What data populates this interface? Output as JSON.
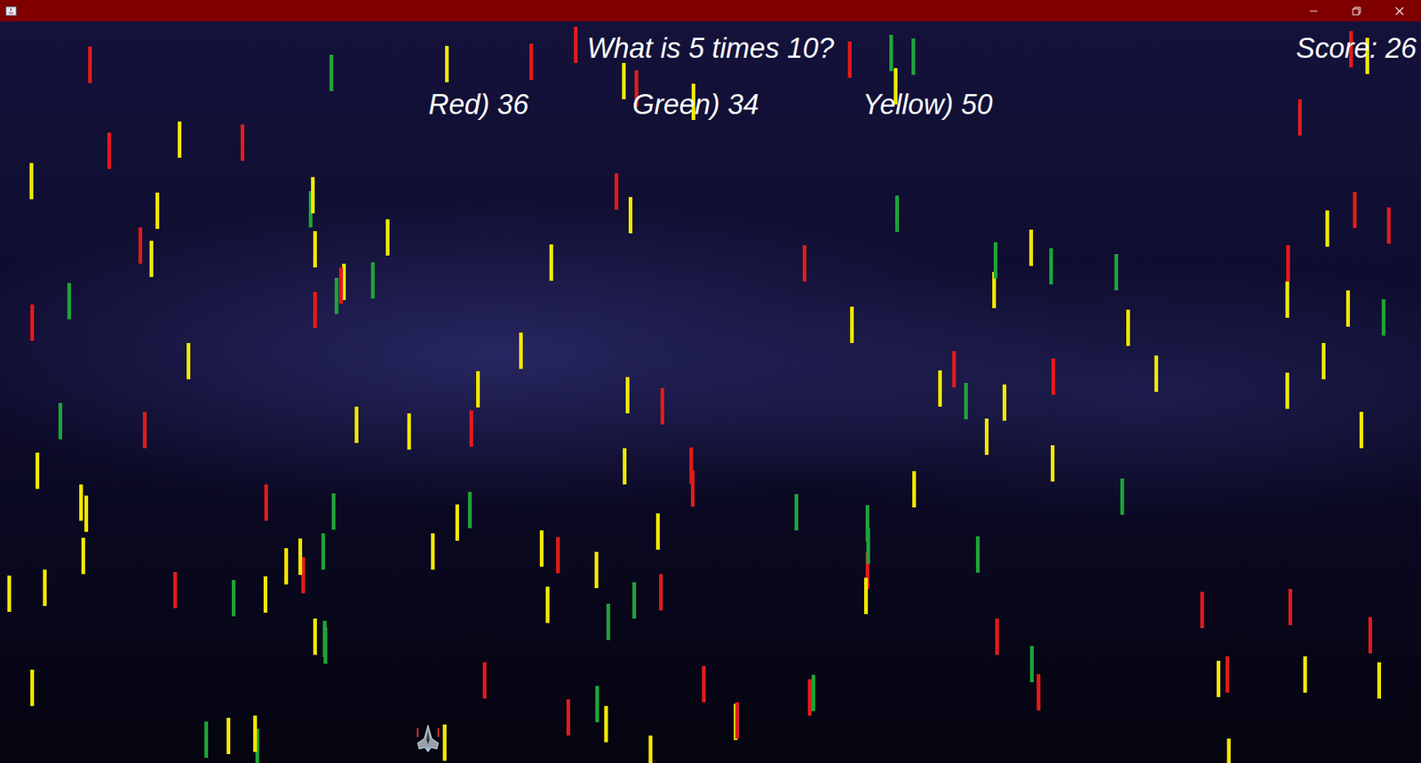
{
  "question": "What is 5 times 10?",
  "score": "Score: 26",
  "answers": [
    {
      "label": "Red) 36"
    },
    {
      "label": "Green) 34"
    },
    {
      "label": "Yellow) 50"
    }
  ],
  "bars": [
    {
      "color": "#f2e600"
    },
    {
      "color": "#e01b1b"
    },
    {
      "color": "#1ea33a"
    },
    {
      "color": "#f2e600"
    },
    {
      "color": "#f2e600"
    },
    {
      "color": "#e01b1b"
    },
    {
      "color": "#1ea33a"
    },
    {
      "color": "#f2e600"
    },
    {
      "color": "#e01b1b"
    },
    {
      "color": "#f2e600"
    },
    {
      "color": "#1ea33a"
    },
    {
      "color": "#f2e600"
    },
    {
      "color": "#e01b1b"
    },
    {
      "color": "#f2e600"
    },
    {
      "color": "#f2e600"
    },
    {
      "color": "#1ea33a"
    },
    {
      "color": "#e01b1b"
    },
    {
      "color": "#f2e600"
    },
    {
      "color": "#e01b1b"
    },
    {
      "color": "#f2e600"
    },
    {
      "color": "#f2e600"
    },
    {
      "color": "#1ea33a"
    },
    {
      "color": "#e01b1b"
    },
    {
      "color": "#f2e600"
    },
    {
      "color": "#1ea33a"
    },
    {
      "color": "#f2e600"
    },
    {
      "color": "#e01b1b"
    },
    {
      "color": "#f2e600"
    },
    {
      "color": "#f2e600"
    },
    {
      "color": "#e01b1b"
    },
    {
      "color": "#1ea33a"
    },
    {
      "color": "#f2e600"
    },
    {
      "color": "#e01b1b"
    },
    {
      "color": "#f2e600"
    },
    {
      "color": "#1ea33a"
    },
    {
      "color": "#f2e600"
    },
    {
      "color": "#e01b1b"
    },
    {
      "color": "#f2e600"
    },
    {
      "color": "#1ea33a"
    },
    {
      "color": "#e01b1b"
    },
    {
      "color": "#f2e600"
    },
    {
      "color": "#f2e600"
    },
    {
      "color": "#e01b1b"
    },
    {
      "color": "#1ea33a"
    },
    {
      "color": "#f2e600"
    },
    {
      "color": "#e01b1b"
    },
    {
      "color": "#f2e600"
    },
    {
      "color": "#1ea33a"
    },
    {
      "color": "#f2e600"
    },
    {
      "color": "#e01b1b"
    },
    {
      "color": "#f2e600"
    },
    {
      "color": "#1ea33a"
    },
    {
      "color": "#e01b1b"
    },
    {
      "color": "#f2e600"
    },
    {
      "color": "#f2e600"
    },
    {
      "color": "#e01b1b"
    },
    {
      "color": "#1ea33a"
    },
    {
      "color": "#f2e600"
    },
    {
      "color": "#e01b1b"
    },
    {
      "color": "#f2e600"
    },
    {
      "color": "#1ea33a"
    },
    {
      "color": "#f2e600"
    },
    {
      "color": "#e01b1b"
    },
    {
      "color": "#f2e600"
    },
    {
      "color": "#1ea33a"
    },
    {
      "color": "#e01b1b"
    },
    {
      "color": "#f2e600"
    },
    {
      "color": "#f2e600"
    },
    {
      "color": "#e01b1b"
    },
    {
      "color": "#1ea33a"
    },
    {
      "color": "#f2e600"
    },
    {
      "color": "#e01b1b"
    },
    {
      "color": "#f2e600"
    },
    {
      "color": "#1ea33a"
    },
    {
      "color": "#f2e600"
    },
    {
      "color": "#e01b1b"
    },
    {
      "color": "#f2e600"
    },
    {
      "color": "#1ea33a"
    },
    {
      "color": "#e01b1b"
    },
    {
      "color": "#f2e600"
    },
    {
      "color": "#f2e600"
    },
    {
      "color": "#e01b1b"
    },
    {
      "color": "#1ea33a"
    },
    {
      "color": "#f2e600"
    },
    {
      "color": "#e01b1b"
    },
    {
      "color": "#f2e600"
    },
    {
      "color": "#1ea33a"
    },
    {
      "color": "#f2e600"
    },
    {
      "color": "#e01b1b"
    },
    {
      "color": "#f2e600"
    },
    {
      "color": "#1ea33a"
    },
    {
      "color": "#e01b1b"
    },
    {
      "color": "#f2e600"
    },
    {
      "color": "#f2e600"
    },
    {
      "color": "#e01b1b"
    },
    {
      "color": "#1ea33a"
    },
    {
      "color": "#f2e600"
    },
    {
      "color": "#e01b1b"
    },
    {
      "color": "#f2e600"
    },
    {
      "color": "#1ea33a"
    },
    {
      "color": "#f2e600"
    },
    {
      "color": "#e01b1b"
    },
    {
      "color": "#f2e600"
    },
    {
      "color": "#1ea33a"
    },
    {
      "color": "#e01b1b"
    },
    {
      "color": "#f2e600"
    },
    {
      "color": "#f2e600"
    },
    {
      "color": "#e01b1b"
    },
    {
      "color": "#1ea33a"
    },
    {
      "color": "#f2e600"
    },
    {
      "color": "#e01b1b"
    },
    {
      "color": "#f2e600"
    },
    {
      "color": "#1ea33a"
    },
    {
      "color": "#f2e600"
    },
    {
      "color": "#e01b1b"
    },
    {
      "color": "#f2e600"
    },
    {
      "color": "#1ea33a"
    },
    {
      "color": "#e01b1b"
    },
    {
      "color": "#f2e600"
    },
    {
      "color": "#f2e600"
    },
    {
      "color": "#e01b1b"
    },
    {
      "color": "#1ea33a"
    },
    {
      "color": "#f2e600"
    },
    {
      "color": "#e01b1b"
    },
    {
      "color": "#f2e600"
    },
    {
      "color": "#1ea33a"
    },
    {
      "color": "#f2e600"
    },
    {
      "color": "#e01b1b"
    },
    {
      "color": "#f2e600"
    },
    {
      "color": "#1ea33a"
    },
    {
      "color": "#f2e600"
    },
    {
      "color": "#e01b1b"
    },
    {
      "color": "#f2e600"
    },
    {
      "color": "#1ea33a"
    },
    {
      "color": "#e01b1b"
    },
    {
      "color": "#f2e600"
    },
    {
      "color": "#f2e600"
    },
    {
      "color": "#e01b1b"
    },
    {
      "color": "#1ea33a"
    },
    {
      "color": "#f2e600"
    }
  ]
}
